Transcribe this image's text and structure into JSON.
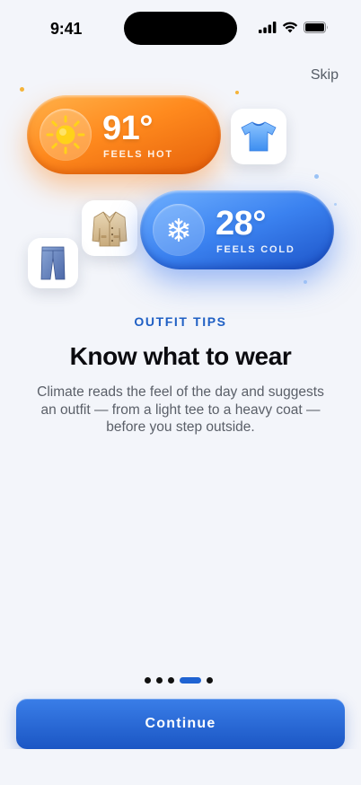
{
  "status_bar": {
    "time": "9:41"
  },
  "header": {
    "skip_label": "Skip"
  },
  "hero": {
    "hot": {
      "temp": "91°",
      "label": "FEELS HOT",
      "icon": "sun-icon"
    },
    "cold": {
      "temp": "28°",
      "label": "FEELS COLD",
      "icon": "snowflake-icon"
    },
    "items": [
      "t-shirt-icon",
      "coat-icon",
      "jeans-icon"
    ]
  },
  "content": {
    "eyebrow": "OUTFIT TIPS",
    "title": "Know what to wear",
    "body": "Climate reads the feel of the day and suggests an outfit — from a light tee to a heavy coat — before you step outside."
  },
  "pager": {
    "total": 5,
    "active_index": 3
  },
  "footer": {
    "continue_label": "Continue"
  },
  "colors": {
    "accent": "#1f5fc4",
    "hot": "#ff8a1e",
    "cold": "#3b82f0"
  }
}
